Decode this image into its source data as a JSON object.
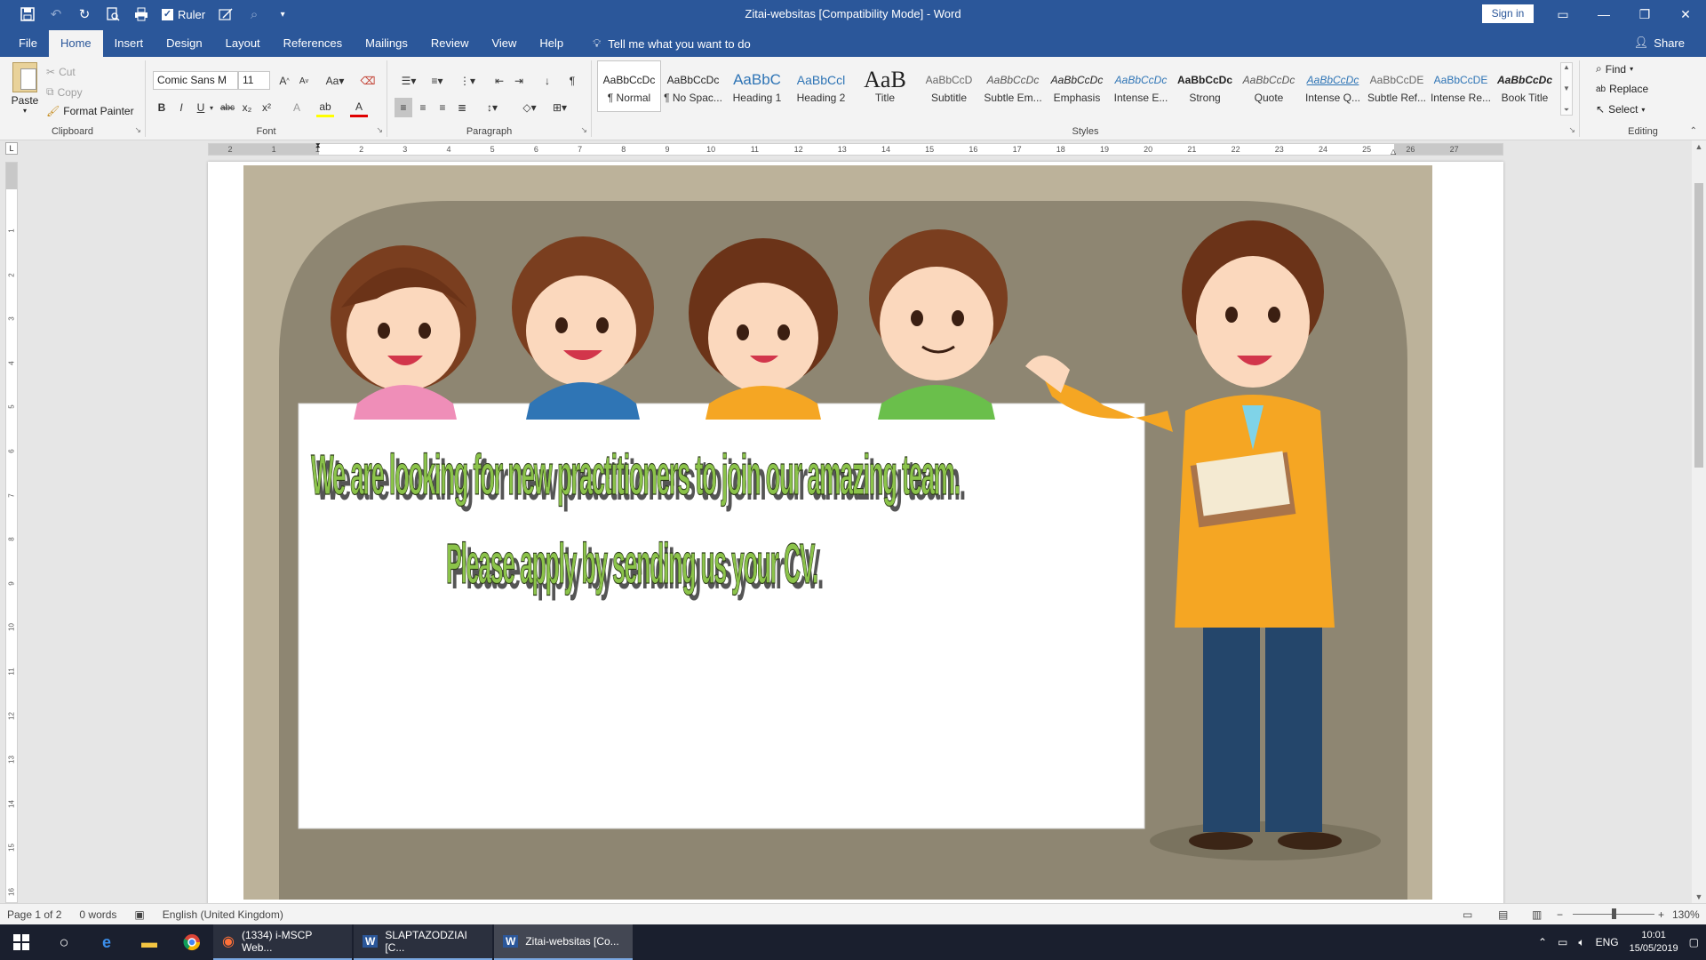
{
  "app": {
    "title": "Zitai-websitas [Compatibility Mode]  -  Word",
    "sign_in": "Sign in",
    "qat_ruler_label": "Ruler"
  },
  "tabs": [
    "File",
    "Home",
    "Insert",
    "Design",
    "Layout",
    "References",
    "Mailings",
    "Review",
    "View",
    "Help"
  ],
  "tell_me": "Tell me what you want to do",
  "share": "Share",
  "clipboard": {
    "paste": "Paste",
    "cut": "Cut",
    "copy": "Copy",
    "format_painter": "Format Painter",
    "label": "Clipboard"
  },
  "font": {
    "name": "Comic Sans M",
    "size": "11",
    "label": "Font",
    "bold": "B",
    "italic": "I",
    "underline": "U",
    "strike": "abc",
    "subscript": "x₂",
    "superscript": "x²",
    "grow": "A",
    "shrink": "A",
    "case": "Aa",
    "effects": "A",
    "highlight": "ab",
    "color": "A"
  },
  "paragraph": {
    "label": "Paragraph",
    "show_marks": "¶"
  },
  "styles": {
    "label": "Styles",
    "items": [
      {
        "preview": "AaBbCcDc",
        "name": "¶ Normal"
      },
      {
        "preview": "AaBbCcDc",
        "name": "¶ No Spac..."
      },
      {
        "preview": "AaBbC",
        "name": "Heading 1"
      },
      {
        "preview": "AaBbCcl",
        "name": "Heading 2"
      },
      {
        "preview": "AaB",
        "name": "Title"
      },
      {
        "preview": "AaBbCcD",
        "name": "Subtitle"
      },
      {
        "preview": "AaBbCcDc",
        "name": "Subtle Em..."
      },
      {
        "preview": "AaBbCcDc",
        "name": "Emphasis"
      },
      {
        "preview": "AaBbCcDc",
        "name": "Intense E..."
      },
      {
        "preview": "AaBbCcDc",
        "name": "Strong"
      },
      {
        "preview": "AaBbCcDc",
        "name": "Quote"
      },
      {
        "preview": "AaBbCcDc",
        "name": "Intense Q..."
      },
      {
        "preview": "AaBbCcDE",
        "name": "Subtle Ref..."
      },
      {
        "preview": "AaBbCcDE",
        "name": "Intense Re..."
      },
      {
        "preview": "AaBbCcDc",
        "name": "Book Title"
      }
    ]
  },
  "editing": {
    "find": "Find",
    "replace": "Replace",
    "select": "Select",
    "label": "Editing"
  },
  "ruler": {
    "h_numbers": [
      "2",
      "1",
      "1",
      "2",
      "3",
      "4",
      "5",
      "6",
      "7",
      "8",
      "9",
      "10",
      "11",
      "12",
      "13",
      "14",
      "15",
      "16",
      "17",
      "18",
      "19",
      "20",
      "21",
      "22",
      "23",
      "24",
      "25",
      "26",
      "27"
    ],
    "v_numbers": [
      "1",
      "2",
      "3",
      "4",
      "5",
      "6",
      "7",
      "8",
      "9",
      "10",
      "11",
      "12",
      "13",
      "14",
      "15",
      "16"
    ],
    "tab_selector": "L"
  },
  "document": {
    "line1": "We are looking for new practitioners to join our amazing team.",
    "line2": "Please apply by sending us your CV."
  },
  "status": {
    "page": "Page 1 of 2",
    "words": "0 words",
    "language": "English (United Kingdom)",
    "zoom": "130%",
    "zoom_minus": "−",
    "zoom_plus": "+"
  },
  "taskbar": {
    "apps": [
      {
        "label": "(1334) i-MSCP Web...",
        "icon": "firefox-icon"
      },
      {
        "label": "SLAPTAZODZIAI [C...",
        "icon": "word-icon"
      },
      {
        "label": "Zitai-websitas [Co...",
        "icon": "word-icon"
      }
    ],
    "lang": "ENG",
    "time": "10:01",
    "date": "15/05/2019"
  },
  "colors": {
    "word_blue": "#2b579a",
    "wordart_green": "#8bc34a",
    "picture_bg": "#bcb29a"
  }
}
